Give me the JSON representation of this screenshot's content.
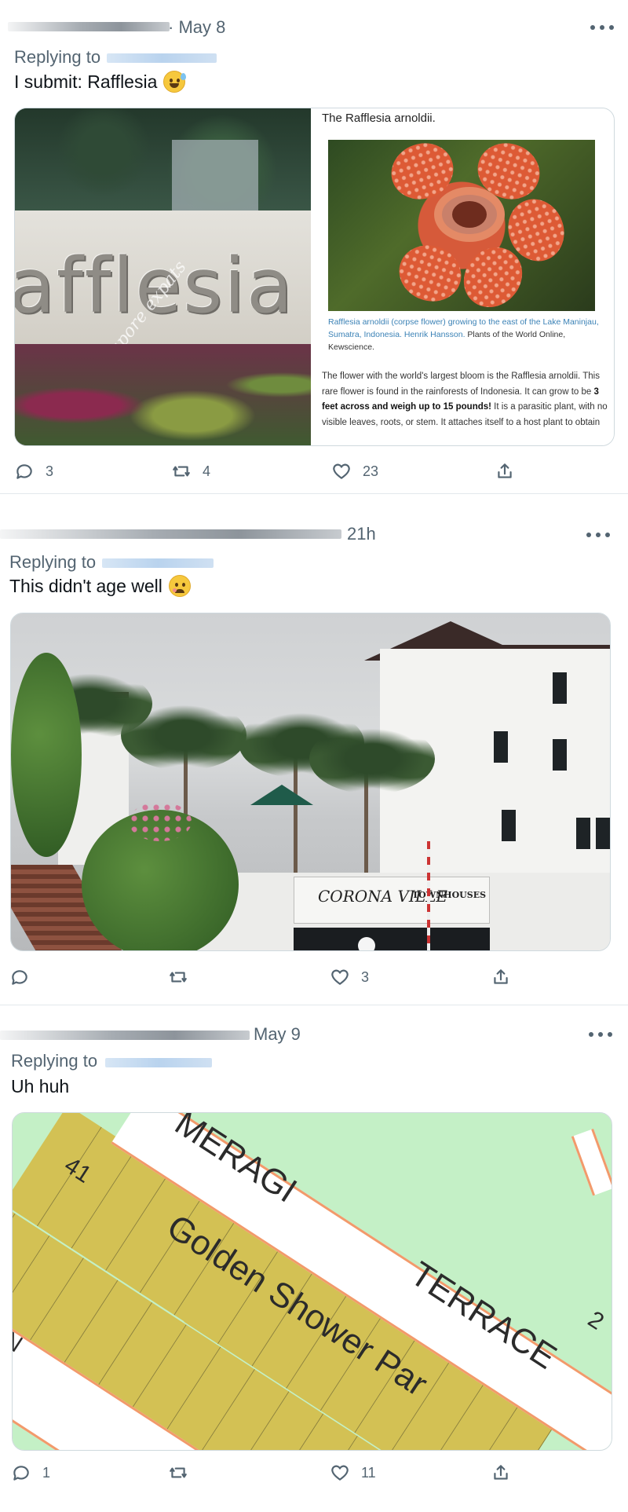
{
  "tweets": [
    {
      "date": "· May 8",
      "replying_to": "Replying to",
      "text": "I submit: Rafflesia",
      "emoji": "sweat-smile",
      "media": {
        "sign_text": "afflesia",
        "watermark": "singapore expats",
        "article": {
          "title": "The Rafflesia arnoldii.",
          "caption_link": "Rafflesia arnoldii (corpse flower) growing to the east of the Lake Maninjau, Sumatra, Indonesia. Henrik Hansson.",
          "caption_rest": " Plants of the World Online, Kewscience.",
          "body_1": "The flower with the world's largest bloom is the Rafflesia arnoldii. This rare flower is found in the rainforests of Indonesia. It can grow to be ",
          "body_bold": "3 feet across and weigh up to 15 pounds!",
          "body_2": " It is a parasitic plant, with no visible leaves, roots, or stem. It attaches itself to a host plant to obtain"
        }
      },
      "actions": {
        "replies": "3",
        "retweets": "4",
        "likes": "23"
      }
    },
    {
      "date": "21h",
      "replying_to": "Replying to",
      "text": "This didn't age well",
      "emoji": "pleading-face",
      "media": {
        "sign_main": "CORONA VILLE",
        "sign_sub": "TOWNHOUSES"
      },
      "actions": {
        "replies": "",
        "retweets": "",
        "likes": "3"
      }
    },
    {
      "date": "May 9",
      "replying_to": "Replying to",
      "text": "Uh huh",
      "media": {
        "road_1": "MERAGI",
        "road_2": "TERRACE",
        "park": "Golden Shower Par",
        "lot_number": "41",
        "edge_letter": "N",
        "edge_number": "2"
      },
      "actions": {
        "replies": "1",
        "retweets": "",
        "likes": "11"
      }
    }
  ],
  "colors": {
    "text_primary": "#0f1419",
    "text_secondary": "#536471",
    "link": "#3b82b6",
    "map_green": "#c4f0c6",
    "map_lot": "#d3c154",
    "road_edge": "#f29a6b"
  }
}
